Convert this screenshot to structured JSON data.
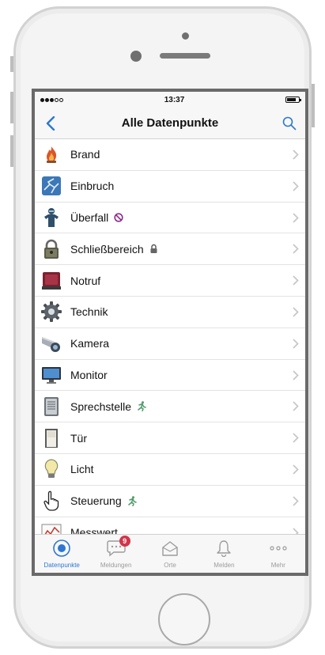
{
  "status_bar": {
    "time": "13:37"
  },
  "nav": {
    "title": "Alle Datenpunkte"
  },
  "list": {
    "items": [
      {
        "label": "Brand",
        "icon": "fire-icon"
      },
      {
        "label": "Einbruch",
        "icon": "broken-glass-icon"
      },
      {
        "label": "Überfall",
        "icon": "robber-icon",
        "badge": "prohibited-icon"
      },
      {
        "label": "Schließbereich",
        "icon": "padlock-icon",
        "badge": "lock-small-icon"
      },
      {
        "label": "Notruf",
        "icon": "alarm-light-icon"
      },
      {
        "label": "Technik",
        "icon": "gear-icon"
      },
      {
        "label": "Kamera",
        "icon": "camera-icon"
      },
      {
        "label": "Monitor",
        "icon": "monitor-icon"
      },
      {
        "label": "Sprechstelle",
        "icon": "intercom-icon",
        "badge": "running-person-icon"
      },
      {
        "label": "Tür",
        "icon": "door-icon"
      },
      {
        "label": "Licht",
        "icon": "light-bulb-icon"
      },
      {
        "label": "Steuerung",
        "icon": "pointing-hand-icon",
        "badge": "running-person-icon"
      },
      {
        "label": "Messwert",
        "icon": "chart-icon"
      }
    ]
  },
  "tabs": [
    {
      "label": "Datenpunkte",
      "icon": "datapoints-icon",
      "active": true
    },
    {
      "label": "Meldungen",
      "icon": "message-icon",
      "badge": "9"
    },
    {
      "label": "Orte",
      "icon": "house-icon"
    },
    {
      "label": "Melden",
      "icon": "bell-icon"
    },
    {
      "label": "Mehr",
      "icon": "more-icon"
    }
  ],
  "colors": {
    "accent": "#2d77d2",
    "badge": "#d0354a",
    "chevron": "#c7c7cc"
  }
}
